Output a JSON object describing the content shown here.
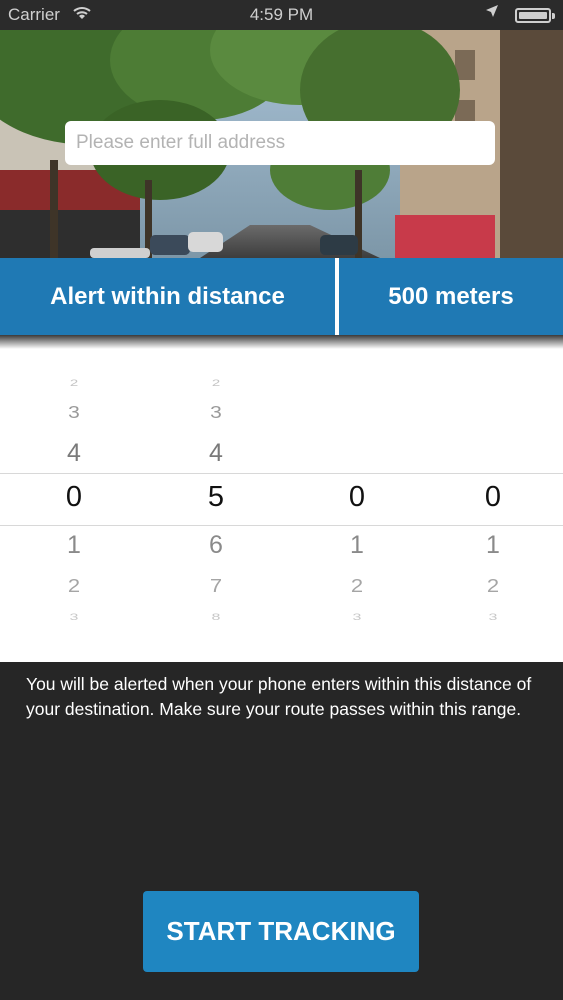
{
  "status_bar": {
    "carrier": "Carrier",
    "time": "4:59 PM"
  },
  "search": {
    "placeholder": "Please enter full address",
    "value": ""
  },
  "alert_bar": {
    "label": "Alert within distance",
    "value": "500 meters"
  },
  "picker": {
    "columns": [
      {
        "above": [
          "2",
          "3",
          "4"
        ],
        "selected": "0",
        "below": [
          "1",
          "2",
          "3"
        ]
      },
      {
        "above": [
          "2",
          "3",
          "4"
        ],
        "selected": "5",
        "below": [
          "6",
          "7",
          "8"
        ]
      },
      {
        "above": [],
        "selected": "0",
        "below": [
          "1",
          "2",
          "3"
        ]
      },
      {
        "above": [],
        "selected": "0",
        "below": [
          "1",
          "2",
          "3"
        ]
      }
    ]
  },
  "info_text": "You will be alerted when your phone enters within this distance of your destination. Make sure your route passes within this range.",
  "start_button": {
    "label": "START TRACKING"
  },
  "colors": {
    "accent_blue": "#1f79b4",
    "button_blue": "#1f86c1",
    "dark_background": "#262626"
  }
}
